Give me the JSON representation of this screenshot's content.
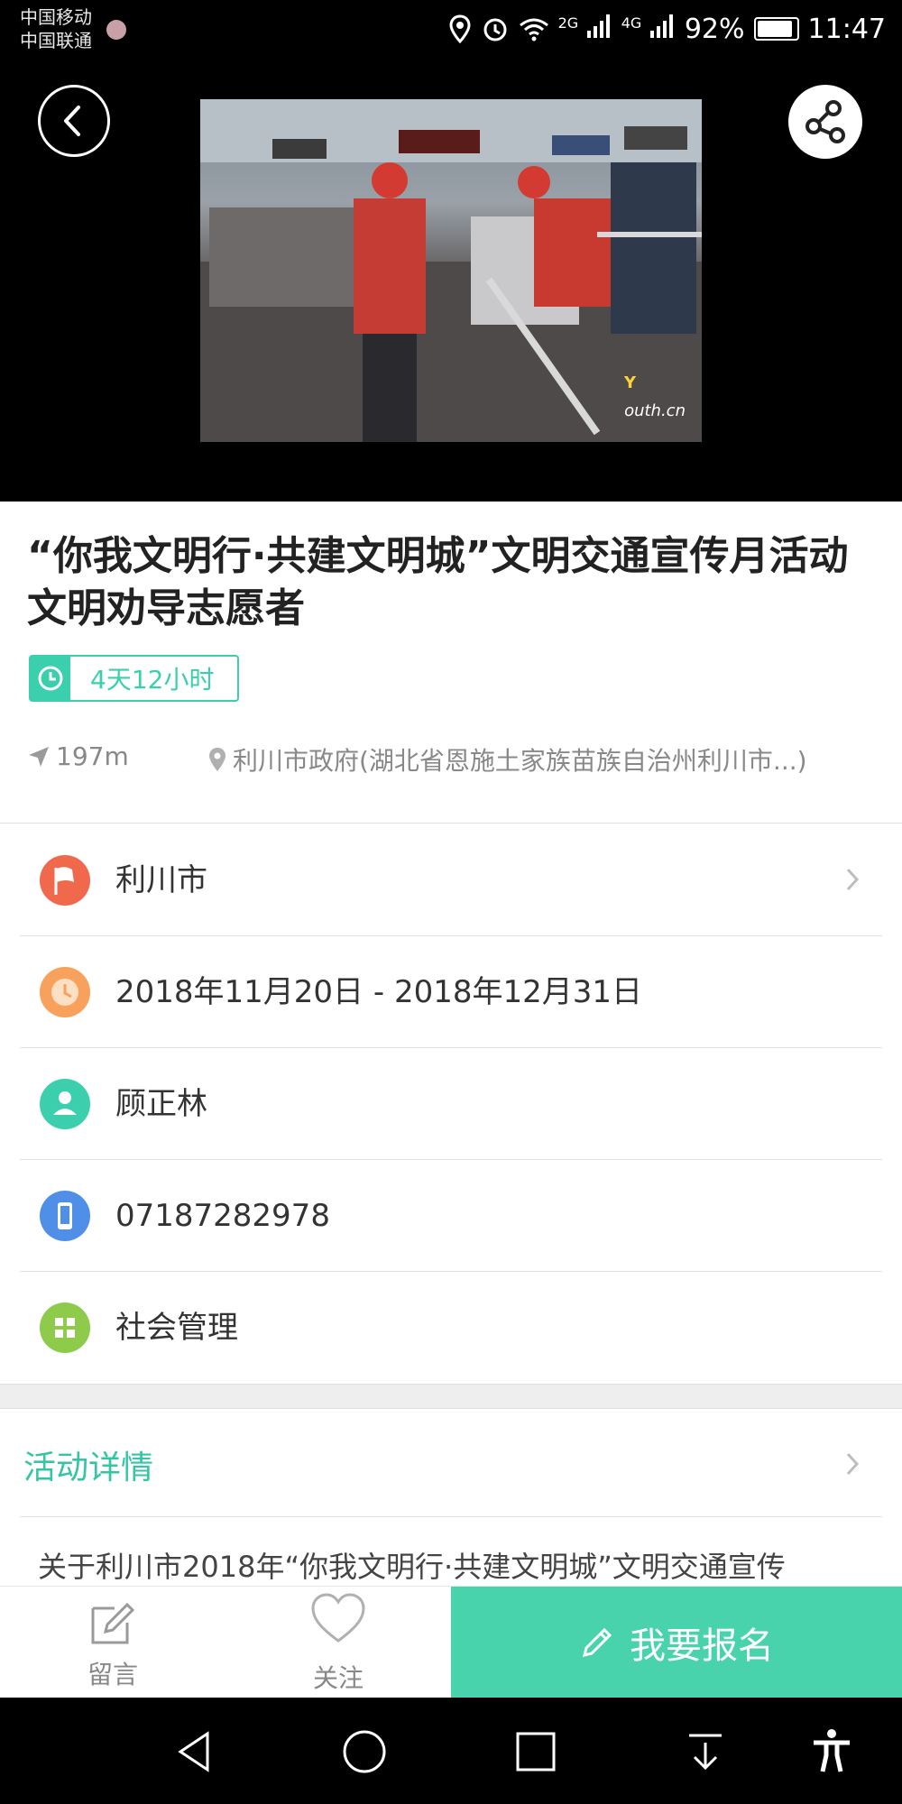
{
  "status_bar": {
    "carrier_1": "中国移动",
    "carrier_2": "中国联通",
    "net_1": "2G",
    "net_2": "4G",
    "battery": "92%",
    "time": "11:47"
  },
  "hero": {
    "back_icon": "chevron-left-icon",
    "share_icon": "share-icon",
    "watermark": "outh.cn"
  },
  "event": {
    "title": "“你我文明行·共建文明城”文明交通宣传月活动文明劝导志愿者",
    "duration": "4天12小时",
    "distance": "197m",
    "address": "利川市政府(湖北省恩施土家族苗族自治州利川市...)"
  },
  "info": {
    "city": "利川市",
    "date_range": "2018年11月20日 - 2018年12月31日",
    "contact": "顾正林",
    "phone": "07187282978",
    "category": "社会管理"
  },
  "details": {
    "heading": "活动详情",
    "preview": "关于利川市2018年“你我文明行·共建文明城”文明交通宣传"
  },
  "actions": {
    "comment_label": "留言",
    "follow_label": "关注",
    "signup_label": "我要报名"
  },
  "colors": {
    "accent": "#49d3ad",
    "city_icon": "#f0694c",
    "date_icon": "#f7a15c",
    "contact_icon": "#3bcfae",
    "phone_icon": "#4f8fe8",
    "category_icon": "#8fcb4b"
  }
}
